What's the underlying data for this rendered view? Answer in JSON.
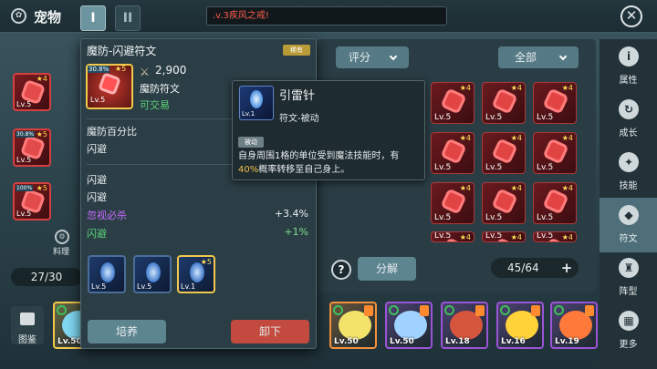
{
  "topbar": {
    "title": "宠物",
    "title_icon": "paw-icon",
    "tabs": [
      "I",
      "II"
    ],
    "notice": ".v.3疾风之戒!",
    "close": "✕"
  },
  "left": {
    "slots": [
      {
        "level": "Lv.5",
        "stars": "★4",
        "pct": ""
      },
      {
        "level": "Lv.5",
        "stars": "★5",
        "pct": "30.8%"
      },
      {
        "level": "Lv.5",
        "stars": "★5",
        "pct": "100%"
      }
    ],
    "cook_label": "料理",
    "count": "27/30",
    "atlas_label": "图鉴"
  },
  "detail": {
    "title": "魔防-闪避符文",
    "tag": "稀有",
    "icon_pct": "30.8%",
    "icon_star": "★5",
    "icon_level": "Lv.5",
    "power": "2,900",
    "type": "魔防符文",
    "tradable": "可交易",
    "main_stat_label": "魔防百分比",
    "main_stat_sub": "闪避",
    "sub_stats": [
      {
        "name": "闪避",
        "value": "",
        "color": "white"
      },
      {
        "name": "闪避",
        "value": "",
        "color": "white"
      },
      {
        "name": "忽视必杀",
        "value": "+3.4%",
        "color": "purple"
      },
      {
        "name": "闪避",
        "value": "+1%",
        "color": "green"
      }
    ],
    "gems": [
      {
        "level": "Lv.5",
        "star": ""
      },
      {
        "level": "Lv.5",
        "star": ""
      },
      {
        "level": "Lv.1",
        "star": "★5"
      }
    ],
    "cultivate": "培养",
    "unequip": "卸下"
  },
  "tooltip": {
    "name": "引雷针",
    "level": "Lv.1",
    "subtitle": "符文-被动",
    "tag": "被动",
    "desc_part1": "自身周围1格的单位受到魔法技能时，有",
    "desc_highlight": "40%",
    "desc_part2": "概率转移至自己身上。"
  },
  "rune_panel": {
    "sort_label": "评分",
    "filter_label": "全部",
    "rune_level": "Lv.5",
    "rune_star": "★4",
    "help": "?",
    "decompose": "分解",
    "slot_count": "45/64",
    "add": "+"
  },
  "pets": [
    {
      "level": "Lv.50",
      "color": "#7fd7f0",
      "border": "#f2c94c"
    },
    {
      "level": "Lv.50",
      "color": "#f3e36a",
      "border": "#f2913a"
    },
    {
      "level": "Lv.50",
      "color": "#9fd2ff",
      "border": "#9a54d6"
    },
    {
      "level": "Lv.18",
      "color": "#d6553d",
      "border": "#9a54d6"
    },
    {
      "level": "Lv.16",
      "color": "#ffd23a",
      "border": "#9a54d6"
    },
    {
      "level": "Lv.19",
      "color": "#ff7a3a",
      "border": "#9a54d6"
    }
  ],
  "nav": [
    {
      "label": "属性",
      "icon": "info-icon",
      "glyph": "i"
    },
    {
      "label": "成长",
      "icon": "growth-icon",
      "glyph": "↻"
    },
    {
      "label": "技能",
      "icon": "skill-icon",
      "glyph": "✦"
    },
    {
      "label": "符文",
      "icon": "rune-icon",
      "glyph": "◆"
    },
    {
      "label": "阵型",
      "icon": "formation-icon",
      "glyph": "♜"
    },
    {
      "label": "更多",
      "icon": "more-icon",
      "glyph": "▦"
    }
  ]
}
